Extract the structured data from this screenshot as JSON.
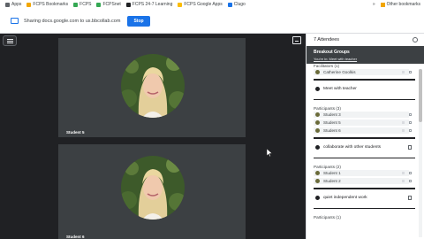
{
  "bookmarks": {
    "items": [
      {
        "label": "Apps",
        "icon": "apps-grid-icon",
        "color": "#5f6368"
      },
      {
        "label": "FCPS Bookmarks",
        "icon": "folder-icon",
        "color": "#f2a600"
      },
      {
        "label": "FCPS",
        "icon": "fcps-icon",
        "color": "#34a853"
      },
      {
        "label": "FCPSnet",
        "icon": "fcpsnet-icon",
        "color": "#34a853"
      },
      {
        "label": "FCPS 24-7 Learning",
        "icon": "learning-icon",
        "color": "#202124"
      },
      {
        "label": "FCPS Google Apps",
        "icon": "google-drive-icon",
        "color": "#fbbc04"
      },
      {
        "label": "Clugo",
        "icon": "clugo-icon",
        "color": "#1a73e8"
      }
    ],
    "other_label": "Other bookmarks"
  },
  "sharebar": {
    "text": "Sharing docs.google.com to us.bbcollab.com",
    "stop_label": "Stop"
  },
  "tiles": [
    {
      "name": "Student 5"
    },
    {
      "name": "Student 6"
    }
  ],
  "panel": {
    "header": "7 Attendees",
    "breakout_title": "Breakout Groups",
    "breakout_sub": "You're in: Meet with teacher",
    "top_partial": "Facilitators (1)",
    "top_members": [
      "Catherine Goolkis"
    ],
    "rooms": [
      {
        "room": "Meet with teacher",
        "group_title": "Participants (3)",
        "members": [
          "Student 3",
          "Student 5",
          "Student 6"
        ]
      },
      {
        "room": "collaborate with other students",
        "group_title": "Participants (2)",
        "members": [
          "Student 1",
          "Student 2"
        ]
      },
      {
        "room": "quiet independent work",
        "group_title": "Participants (1)",
        "members": []
      }
    ]
  },
  "colors": {
    "accent": "#1a73e8",
    "stage_bg": "#202124",
    "tile_bg": "#3c4043"
  }
}
